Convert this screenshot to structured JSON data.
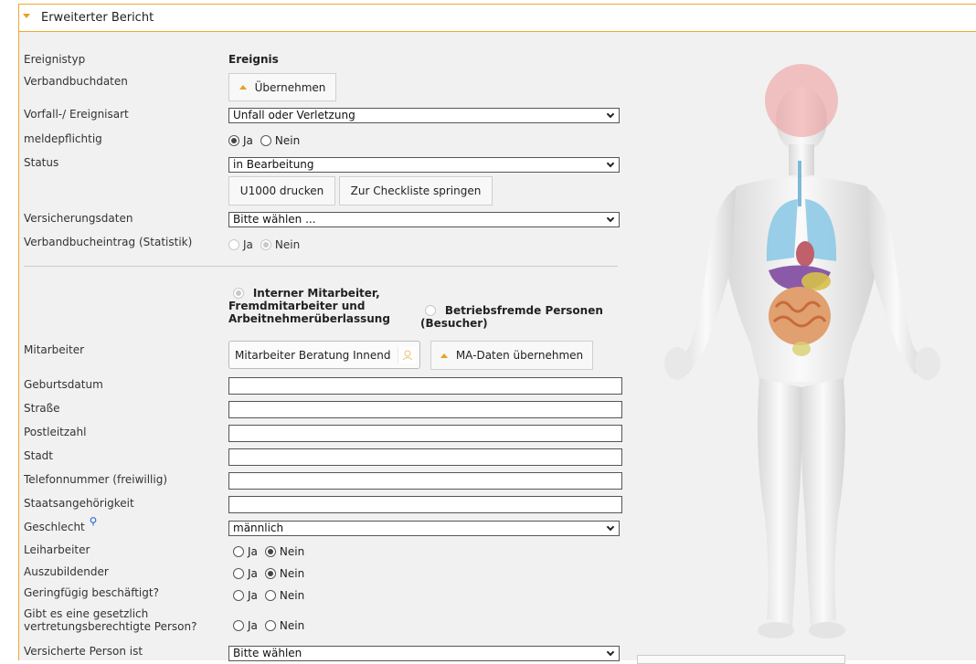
{
  "header": {
    "title": "Erweiterter Bericht"
  },
  "fields": {
    "ereignistyp": {
      "label": "Ereignistyp",
      "value": "Ereignis"
    },
    "verbandbuchdaten": {
      "label": "Verbandbuchdaten",
      "button": "Übernehmen"
    },
    "vorfallart": {
      "label": "Vorfall-/ Ereignisart",
      "value": "Unfall oder Verletzung"
    },
    "meldepflichtig": {
      "label": "meldepflichtig",
      "yes": "Ja",
      "no": "Nein",
      "selected": "Ja"
    },
    "status": {
      "label": "Status",
      "value": "in Bearbeitung",
      "print_button": "U1000 drucken",
      "checklist_button": "Zur Checkliste springen"
    },
    "versicherungsdaten": {
      "label": "Versicherungsdaten",
      "value": "Bitte wählen ..."
    },
    "verbandbucheintrag": {
      "label": "Verbandbucheintrag (Statistik)",
      "yes": "Ja",
      "no": "Nein",
      "selected": "Nein"
    },
    "person_type": {
      "internal_l1": "Interner Mitarbeiter,",
      "internal_l2": "Fremdmitarbeiter und",
      "internal_l3": "Arbeitnehmerüberlassung",
      "external_l1": "Betriebsfremde Personen",
      "external_l2": "(Besucher)"
    },
    "mitarbeiter": {
      "label": "Mitarbeiter",
      "value": "Mitarbeiter Beratung Innend",
      "button": "MA-Daten übernehmen"
    },
    "geburtsdatum": {
      "label": "Geburtsdatum",
      "value": ""
    },
    "strasse": {
      "label": "Straße",
      "value": ""
    },
    "plz": {
      "label": "Postleitzahl",
      "value": ""
    },
    "stadt": {
      "label": "Stadt",
      "value": ""
    },
    "telefon": {
      "label": "Telefonnummer (freiwillig)",
      "value": ""
    },
    "staatsangehoerigkeit": {
      "label": "Staatsangehörigkeit",
      "value": ""
    },
    "geschlecht": {
      "label": "Geschlecht",
      "value": "männlich"
    },
    "leiharbeiter": {
      "label": "Leiharbeiter",
      "yes": "Ja",
      "no": "Nein",
      "selected": "Nein"
    },
    "auszubildender": {
      "label": "Auszubildender",
      "yes": "Ja",
      "no": "Nein",
      "selected": "Nein"
    },
    "geringfuegig": {
      "label": "Geringfügig beschäftigt?",
      "yes": "Ja",
      "no": "Nein",
      "selected": ""
    },
    "vertretung": {
      "label_l1": "Gibt es eine gesetzlich",
      "label_l2": "vertretungsberechtigte Person?",
      "yes": "Ja",
      "no": "Nein",
      "selected": ""
    },
    "versicherte_person": {
      "label": "Versicherte Person ist",
      "value": "Bitte wählen"
    }
  },
  "colors": {
    "accent": "#f0a830",
    "highlight": "#f0a0a0"
  },
  "icons": {
    "header_toggle": "caret-down-icon",
    "person_lookup": "person-icon",
    "info": "info-bulb-icon"
  }
}
